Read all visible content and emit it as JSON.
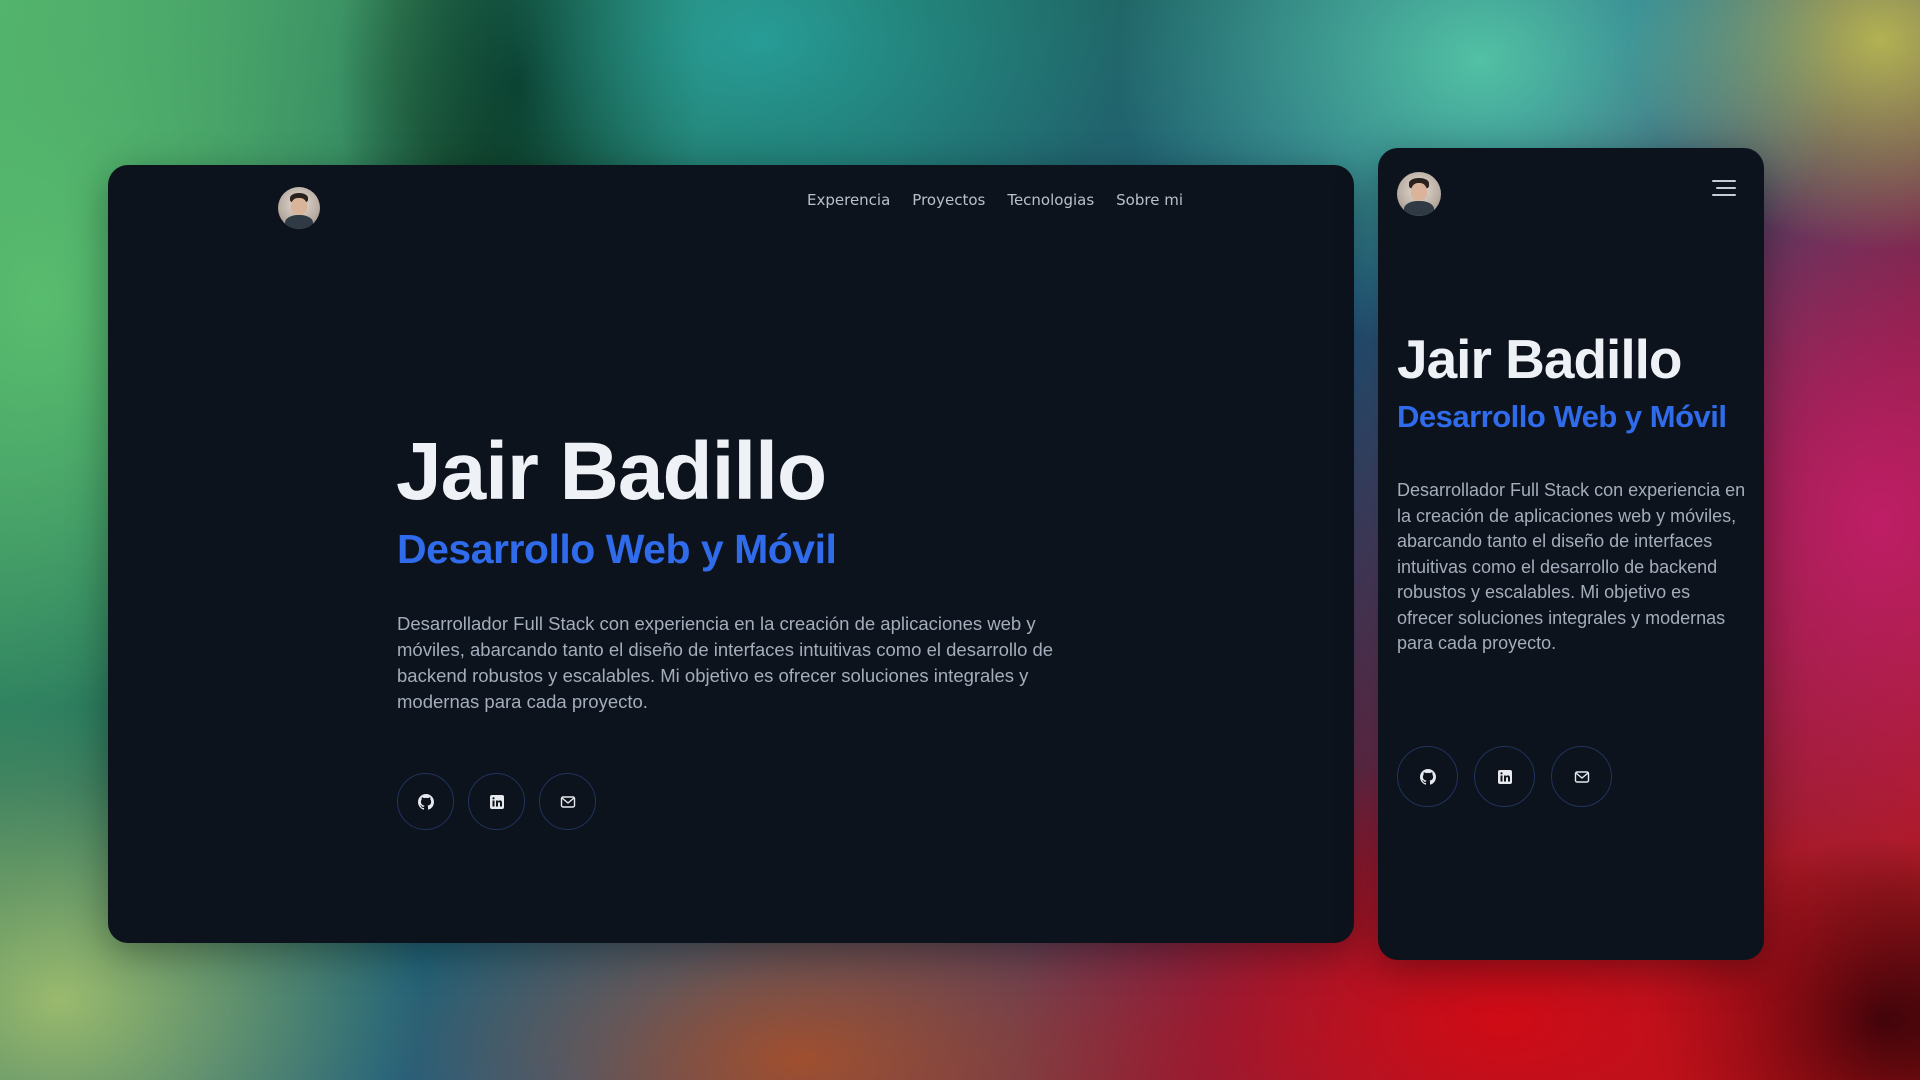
{
  "profile": {
    "name": "Jair Badillo",
    "subtitle": "Desarrollo Web y Móvil",
    "description": "Desarrollador Full Stack con experiencia en la creación de aplicaciones web y móviles, abarcando tanto el diseño de interfaces intuitivas como el desarrollo de backend robustos y escalables. Mi objetivo es ofrecer soluciones integrales y modernas para cada proyecto."
  },
  "nav": {
    "items": [
      "Experencia",
      "Proyectos",
      "Tecnologias",
      "Sobre mi"
    ]
  },
  "socials": {
    "icons": [
      "github-icon",
      "linkedin-icon",
      "mail-icon"
    ]
  },
  "colors": {
    "panel": "#0d131c",
    "title": "#eef1f6",
    "accent": "#2f6bea",
    "text": "#a3adbb",
    "social_border": "#20335e"
  }
}
